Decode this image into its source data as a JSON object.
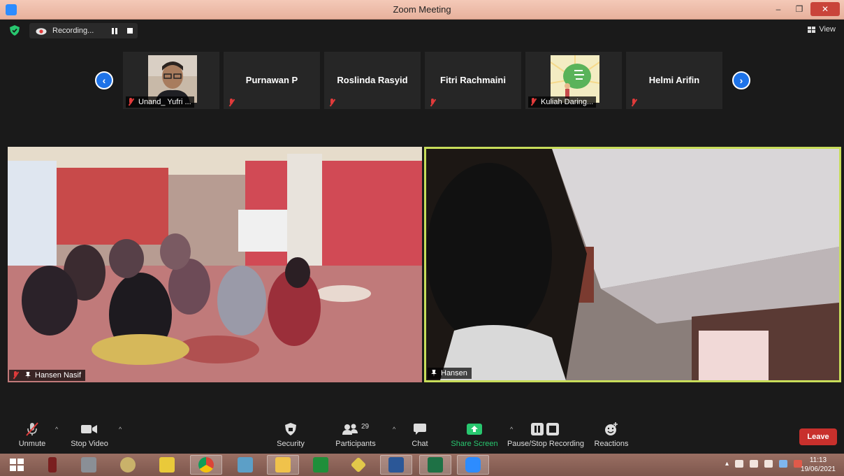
{
  "window": {
    "title": "Zoom Meeting",
    "minimize": "–",
    "restore": "❐",
    "close": "✕"
  },
  "topbar": {
    "recording_label": "Recording...",
    "view_label": "View"
  },
  "participants_strip": {
    "prev_glyph": "‹",
    "next_glyph": "›",
    "tiles": [
      {
        "name": "",
        "label": "Unand_ Yufri ...",
        "type": "photo-man"
      },
      {
        "name": "Purnawan P",
        "label": ""
      },
      {
        "name": "Roslinda Rasyid",
        "label": ""
      },
      {
        "name": "Fitri Rachmaini",
        "label": ""
      },
      {
        "name": "",
        "label": "Kuliah Daring...",
        "type": "photo-logo"
      },
      {
        "name": "Helmi Arifin",
        "label": ""
      }
    ]
  },
  "videos": [
    {
      "label": "Hansen Nasif",
      "muted": true
    },
    {
      "label": "Hansen",
      "muted": false,
      "active_speaker": true
    }
  ],
  "toolbar": {
    "unmute": "Unmute",
    "stop_video": "Stop Video",
    "security": "Security",
    "participants": "Participants",
    "participants_count": "29",
    "chat": "Chat",
    "share_screen": "Share Screen",
    "pause_stop_recording": "Pause/Stop Recording",
    "reactions": "Reactions",
    "leave": "Leave"
  },
  "taskbar": {
    "time": "11:13",
    "date": "19/06/2021",
    "apps": [
      "hbbk-book",
      "file-cabinet",
      "paint",
      "folder-dark",
      "chrome",
      "mail",
      "file-explorer",
      "calculator",
      "app-arrows",
      "word",
      "excel",
      "zoom"
    ]
  },
  "colors": {
    "active_speaker_border": "#c8dd5a",
    "leave": "#c8302c",
    "share_green": "#28c76f",
    "nav_blue": "#1e73e8"
  }
}
